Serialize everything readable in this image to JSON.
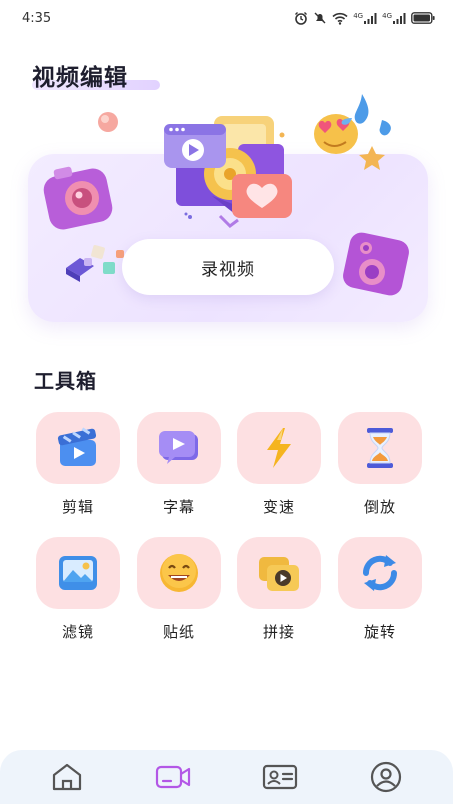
{
  "status_bar": {
    "time": "4:35",
    "network_labels": [
      "4G",
      "4G"
    ]
  },
  "page_title": "视频编辑",
  "hero": {
    "record_button_label": "录视频"
  },
  "toolbox": {
    "title": "工具箱",
    "tools": [
      {
        "label": "剪辑",
        "icon": "clapperboard-icon"
      },
      {
        "label": "字幕",
        "icon": "subtitle-play-icon"
      },
      {
        "label": "变速",
        "icon": "lightning-icon"
      },
      {
        "label": "倒放",
        "icon": "hourglass-icon"
      },
      {
        "label": "滤镜",
        "icon": "picture-icon"
      },
      {
        "label": "贴纸",
        "icon": "smiley-sticker-icon"
      },
      {
        "label": "拼接",
        "icon": "stacked-video-icon"
      },
      {
        "label": "旋转",
        "icon": "rotate-arrows-icon"
      }
    ]
  },
  "bottom_nav": {
    "items": [
      {
        "name": "home",
        "icon": "home-icon"
      },
      {
        "name": "video",
        "icon": "video-camera-icon",
        "active": true
      },
      {
        "name": "id-card",
        "icon": "id-card-icon"
      },
      {
        "name": "profile",
        "icon": "profile-icon"
      }
    ]
  },
  "colors": {
    "tile_bg": "#fde0e2",
    "hero_bg": "#efe6ff",
    "nav_bg": "#eef4fb",
    "active_nav": "#b357e6",
    "inactive_nav": "#555555"
  }
}
